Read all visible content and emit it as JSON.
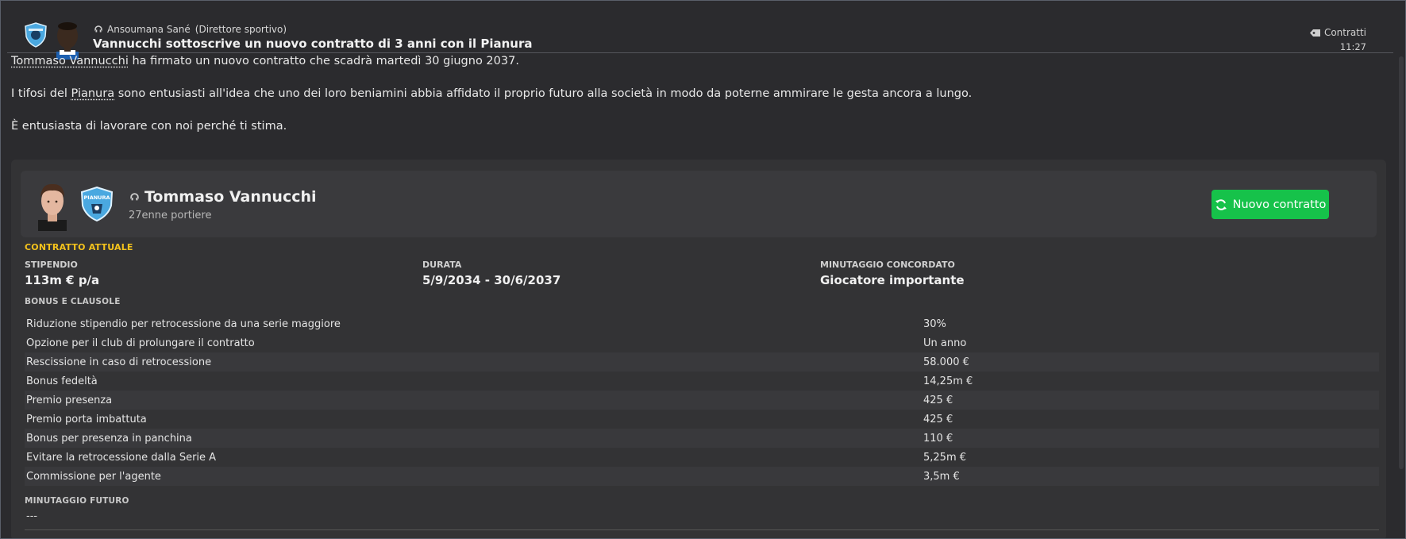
{
  "header": {
    "sender_name": "Ansoumana Sané",
    "sender_role": "(Direttore sportivo)",
    "headline": "Vannucchi sottoscrive un nuovo contratto di 3 anni con il Pianura",
    "tag": "Contratti",
    "time": "11:27"
  },
  "message": {
    "p1_name": "Tommaso Vannucchi",
    "p1_rest": " ha firmato un nuovo contratto che scadrà martedì 30 giugno 2037.",
    "p2_pre": "I tifosi del ",
    "p2_club": "Pianura",
    "p2_rest": " sono entusiasti all'idea che uno dei loro beniamini abbia affidato il proprio futuro alla società in modo da poterne ammirare le gesta ancora a lungo.",
    "p3": "È entusiasta di lavorare con noi perché ti stima."
  },
  "player": {
    "name": "Tommaso Vannucchi",
    "subtitle": "27enne portiere",
    "badge_text": "PIANURA",
    "button_label": "Nuovo contratto"
  },
  "contract": {
    "section_title": "CONTRATTO ATTUALE",
    "salary_label": "STIPENDIO",
    "salary_value": "113m € p/a",
    "duration_label": "DURATA",
    "duration_value": "5/9/2034 - 30/6/2037",
    "playtime_label": "MINUTAGGIO CONCORDATO",
    "playtime_value": "Giocatore importante",
    "bonus_title": "BONUS E CLAUSOLE",
    "clauses": [
      {
        "name": "Riduzione stipendio per retrocessione da una serie maggiore",
        "value": "30%"
      },
      {
        "name": "Opzione per il club di prolungare il contratto",
        "value": "Un anno"
      },
      {
        "name": "Rescissione in caso di retrocessione",
        "value": "58.000 €"
      },
      {
        "name": "Bonus fedeltà",
        "value": "14,25m €"
      },
      {
        "name": "Premio presenza",
        "value": "425 €"
      },
      {
        "name": "Premio porta imbattuta",
        "value": "425 €"
      },
      {
        "name": "Bonus per presenza in panchina",
        "value": "110 €"
      },
      {
        "name": "Evitare la retrocessione dalla Serie A",
        "value": "5,25m €"
      },
      {
        "name": "Commissione per l'agente",
        "value": "3,5m €"
      }
    ],
    "future_title": "MINUTAGGIO FUTURO",
    "future_value": "---"
  },
  "colors": {
    "accent_green": "#16c24a",
    "section_yellow": "#f5c31c",
    "club_blue": "#4aa8e0"
  },
  "icons": [
    "person-icon",
    "tag-icon",
    "refresh-icon",
    "club-badge",
    "player-portrait"
  ]
}
